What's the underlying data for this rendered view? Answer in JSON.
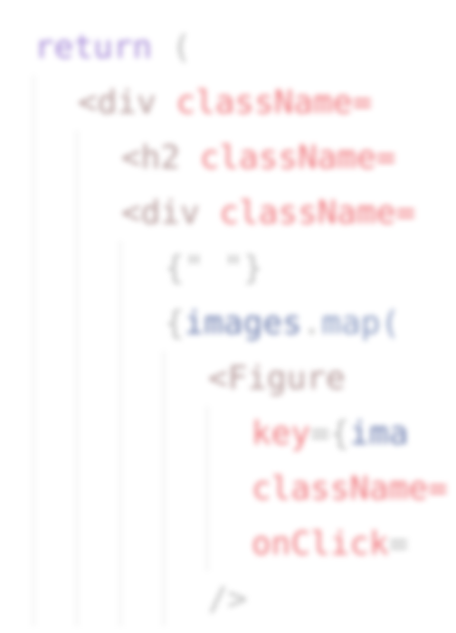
{
  "code": {
    "lines": [
      {
        "indent": 1,
        "tokens": [
          {
            "text": "return",
            "kind": "kw"
          },
          {
            "text": " (",
            "kind": "punct"
          }
        ]
      },
      {
        "indent": 2,
        "tokens": [
          {
            "text": "<div",
            "kind": "tag"
          },
          {
            "text": " className=",
            "kind": "attr"
          }
        ]
      },
      {
        "indent": 3,
        "tokens": [
          {
            "text": "<h2",
            "kind": "tag"
          },
          {
            "text": " className=",
            "kind": "attr"
          }
        ]
      },
      {
        "indent": 3,
        "tokens": [
          {
            "text": "<div",
            "kind": "tag"
          },
          {
            "text": " className=",
            "kind": "attr"
          }
        ]
      },
      {
        "indent": 4,
        "tokens": [
          {
            "text": "{\" \"}",
            "kind": "punct"
          }
        ]
      },
      {
        "indent": 4,
        "tokens": [
          {
            "text": "{",
            "kind": "punct"
          },
          {
            "text": "images",
            "kind": "var"
          },
          {
            "text": ".",
            "kind": "punct"
          },
          {
            "text": "map(",
            "kind": "fn"
          }
        ]
      },
      {
        "indent": 5,
        "tokens": [
          {
            "text": "<Figure",
            "kind": "tag"
          }
        ]
      },
      {
        "indent": 6,
        "tokens": [
          {
            "text": "key",
            "kind": "attr"
          },
          {
            "text": "={",
            "kind": "punct"
          },
          {
            "text": "ima",
            "kind": "var"
          }
        ]
      },
      {
        "indent": 6,
        "tokens": [
          {
            "text": "className=",
            "kind": "attr"
          }
        ]
      },
      {
        "indent": 6,
        "tokens": [
          {
            "text": "onClick",
            "kind": "attr"
          },
          {
            "text": "=",
            "kind": "punct"
          }
        ]
      },
      {
        "indent": 5,
        "tokens": [
          {
            "text": "/>",
            "kind": "punct"
          }
        ]
      }
    ]
  },
  "colors": {
    "keyword": "#a78bd8",
    "tag": "#b59a9a",
    "attribute": "#f07a80",
    "variable": "#6f7fb0",
    "punctuation": "#b8b8b8",
    "background": "#ffffff"
  }
}
